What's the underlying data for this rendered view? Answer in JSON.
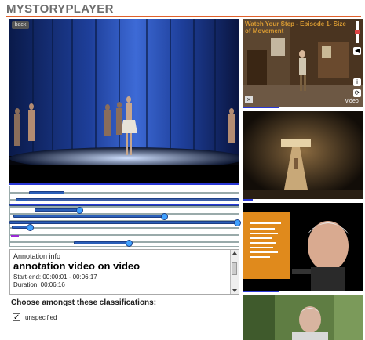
{
  "app": {
    "title": "MYSTORYPLAYER"
  },
  "main_video": {
    "back_label": "back",
    "progress": 1.0
  },
  "timeline": {
    "lanes": 8
  },
  "annotation": {
    "label": "Annotation info",
    "title": "annotation video on video",
    "start_end": "Start-end: 00:00:01 - 00:06:17",
    "duration": "Duration: 00:06:16"
  },
  "classification": {
    "prompt": "Choose amongst these classifications:",
    "option": {
      "label": "unspecified",
      "checked": true,
      "mark": "✓"
    }
  },
  "side_videos": [
    {
      "title": "Watch Your Step - Episode 1- Size of Movement",
      "close": "×",
      "label": "video",
      "progress": 0.3
    },
    {
      "progress": 0.1
    },
    {
      "progress": 0.3
    },
    {}
  ],
  "controls": {
    "zoom_icon": "z",
    "info_icon": "i",
    "refresh_icon": "⟳",
    "volume_icon": "◀"
  },
  "colors": {
    "accent": "#e0602a",
    "progress": "#2b39d6",
    "segment": "#2b5fb8"
  }
}
